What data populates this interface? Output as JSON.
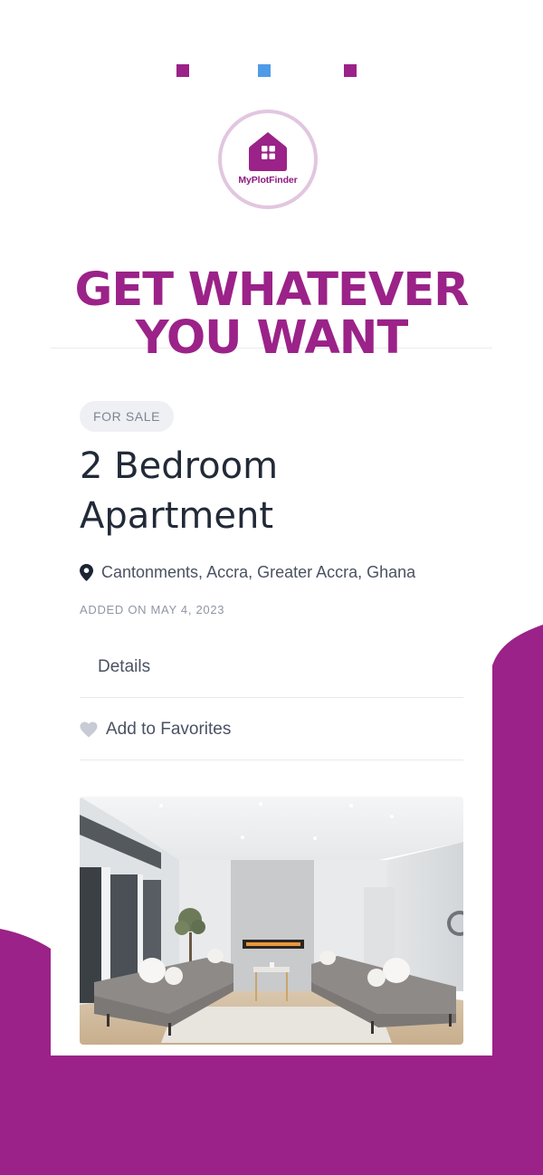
{
  "brand": {
    "name": "MyPlotFinder",
    "logo_icon": "house-with-window-icon",
    "colors": {
      "primary": "#9b2288",
      "accent": "#4f9be8",
      "ring": "#e2c6e0"
    }
  },
  "headline": {
    "line1": "GET WHATEVER",
    "line2": "YOU WANT"
  },
  "listing": {
    "badge": "FOR SALE",
    "title_line1": "2 Bedroom",
    "title_line2": "Apartment",
    "address": "Cantonments, Accra, Greater Accra, Ghana",
    "address_icon": "map-pin-icon",
    "added": "ADDED ON MAY 4, 2023"
  },
  "actions": {
    "details_label": "Details",
    "favorites_label": "Add to Favorites",
    "favorites_icon": "heart-icon"
  },
  "photo": {
    "subject": "living-room-photo"
  }
}
